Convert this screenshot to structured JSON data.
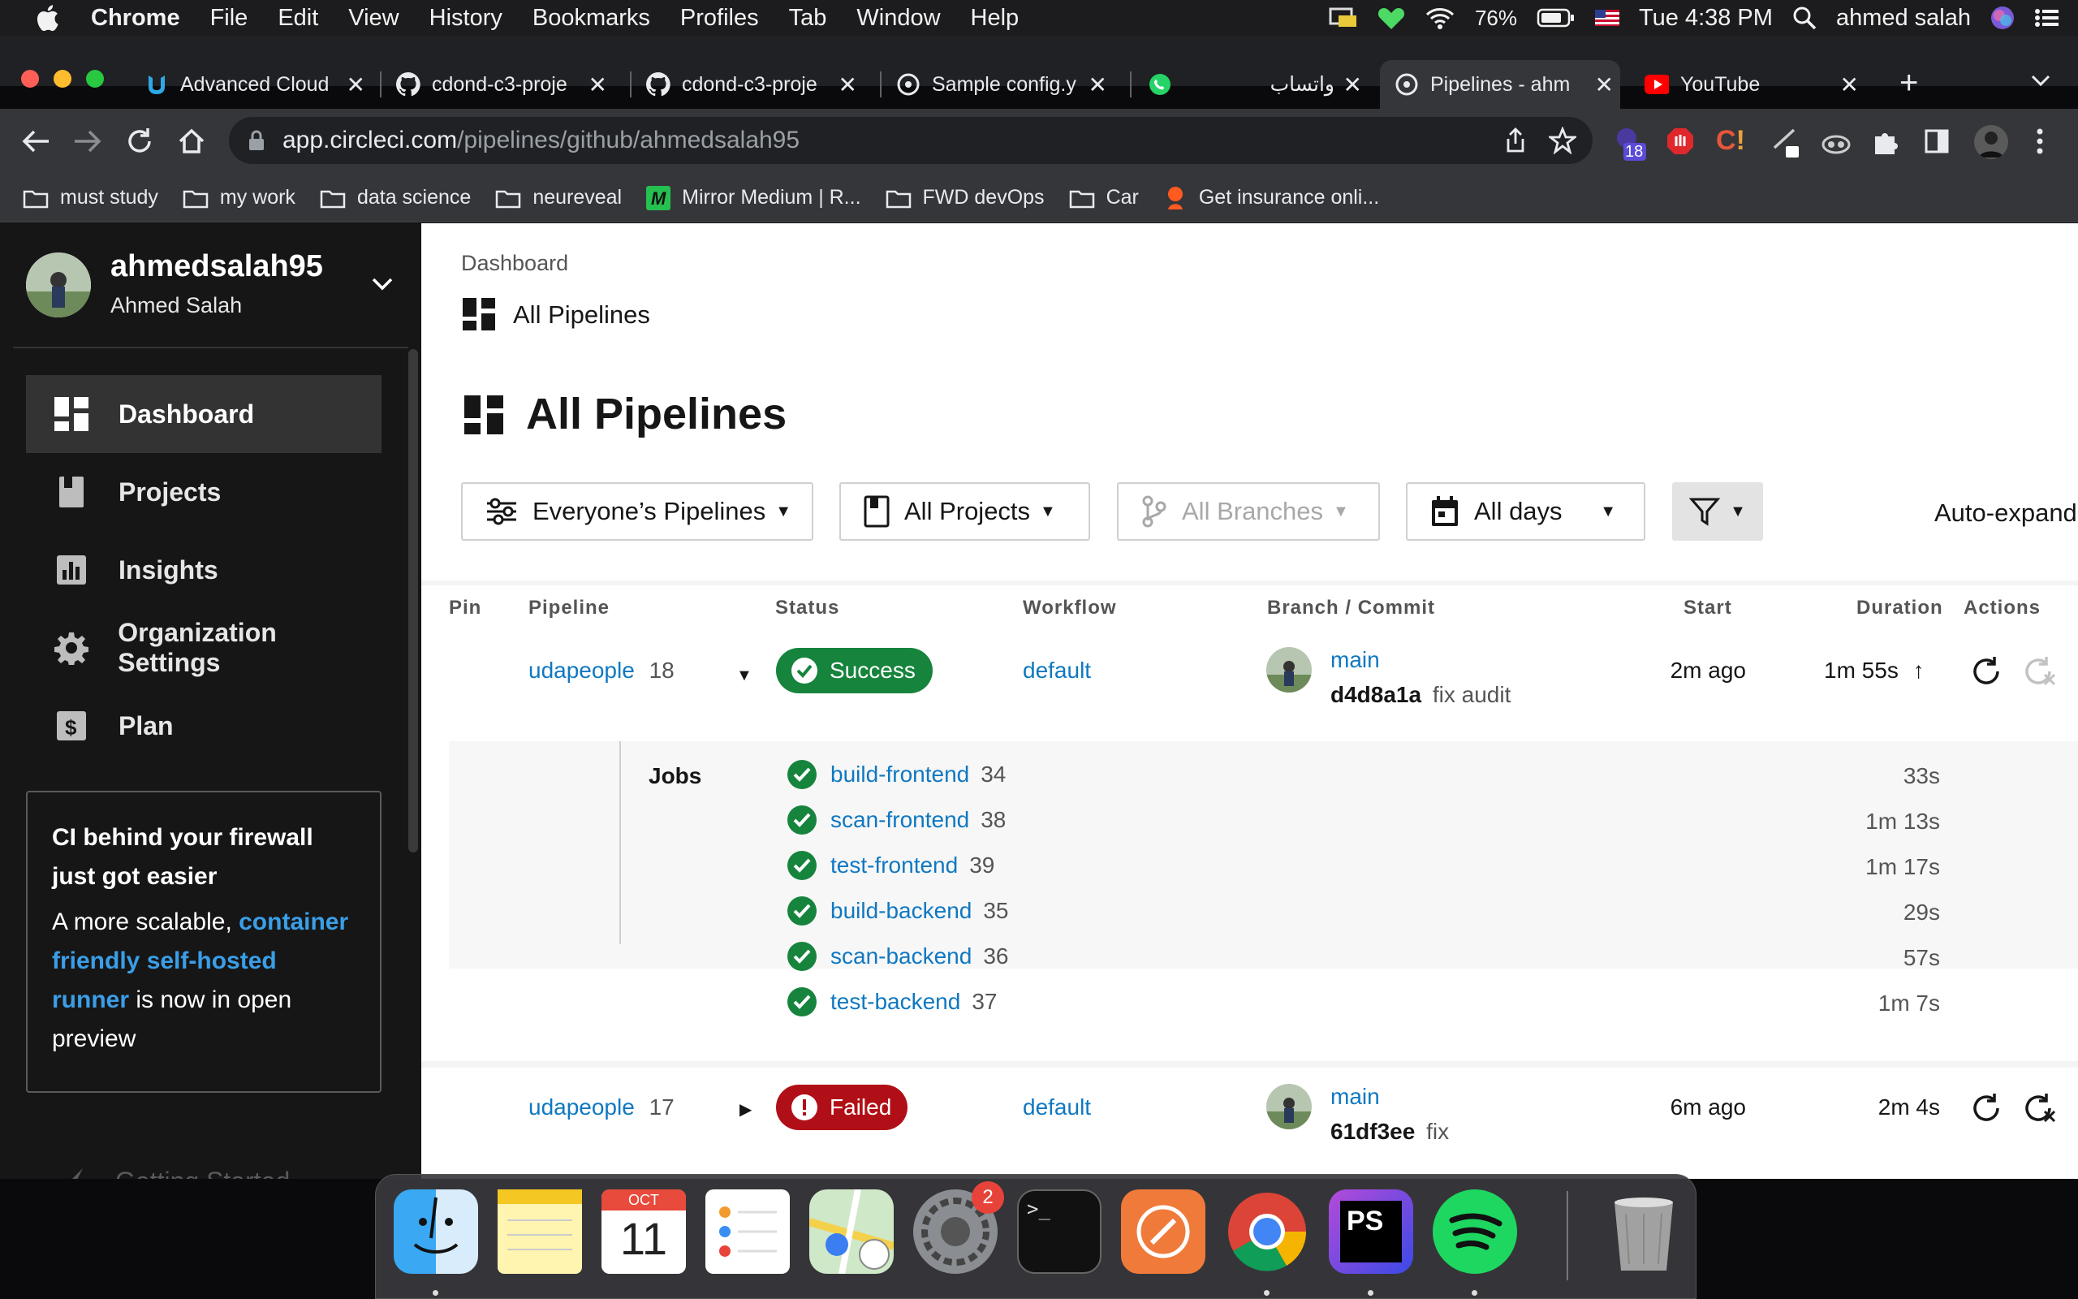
{
  "menubar": {
    "app": "Chrome",
    "items": [
      "File",
      "Edit",
      "View",
      "History",
      "Bookmarks",
      "Profiles",
      "Tab",
      "Window",
      "Help"
    ],
    "battery": "76%",
    "datetime": "Tue 4:38 PM",
    "user": "ahmed salah"
  },
  "tabs": [
    {
      "title": "Advanced Cloud",
      "icon": "udacity-icon"
    },
    {
      "title": "cdond-c3-proje",
      "icon": "github-icon"
    },
    {
      "title": "cdond-c3-proje",
      "icon": "github-icon"
    },
    {
      "title": "Sample config.y",
      "icon": "circleci-icon"
    },
    {
      "title": "",
      "icon": "whatsapp-icon"
    },
    {
      "title": "واتساب",
      "icon": ""
    },
    {
      "title": "Pipelines - ahm",
      "icon": "circleci-icon"
    },
    {
      "title": "YouTube",
      "icon": "youtube-icon"
    }
  ],
  "address": {
    "host": "app.circleci.com",
    "path": "/pipelines/github/ahmedsalah95"
  },
  "extension_badge": "18",
  "bookmarks": [
    "must study",
    "my work",
    "data science",
    "neureveal",
    "Mirror Medium | R...",
    "FWD devOps",
    "Car",
    "Get insurance onli..."
  ],
  "sidebar": {
    "org": "ahmedsalah95",
    "user": "Ahmed Salah",
    "nav": [
      "Dashboard",
      "Projects",
      "Insights",
      "Organization Settings",
      "Plan"
    ],
    "promo": {
      "title": "CI behind your firewall just got easier",
      "text_before": "A more scalable,",
      "link": "container friendly self-hosted runner",
      "text_after": "is now in open preview"
    },
    "partial_item": "Getting Started"
  },
  "main": {
    "breadcrumb": "Dashboard",
    "subtitle": "All Pipelines",
    "title": "All Pipelines",
    "filters": {
      "pipelines": "Everyone’s Pipelines",
      "projects": "All Projects",
      "branches": "All Branches",
      "days": "All days"
    },
    "auto_expand": "Auto-expand",
    "columns": [
      "Pin",
      "Pipeline",
      "Status",
      "Workflow",
      "Branch / Commit",
      "Start",
      "Duration",
      "Actions"
    ],
    "pipelines": [
      {
        "project": "udapeople",
        "number": "18",
        "status": "Success",
        "workflow": "default",
        "branch": "main",
        "commit": "d4d8a1a",
        "message": "fix audit",
        "start": "2m ago",
        "duration": "1m 55s",
        "jobs_label": "Jobs",
        "jobs": [
          {
            "name": "build-frontend",
            "number": "34",
            "duration": "33s"
          },
          {
            "name": "scan-frontend",
            "number": "38",
            "duration": "1m 13s"
          },
          {
            "name": "test-frontend",
            "number": "39",
            "duration": "1m 17s"
          },
          {
            "name": "build-backend",
            "number": "35",
            "duration": "29s"
          },
          {
            "name": "scan-backend",
            "number": "36",
            "duration": "57s"
          },
          {
            "name": "test-backend",
            "number": "37",
            "duration": "1m 7s"
          }
        ]
      },
      {
        "project": "udapeople",
        "number": "17",
        "status": "Failed",
        "workflow": "default",
        "branch": "main",
        "commit": "61df3ee",
        "message": "fix",
        "start": "6m ago",
        "duration": "2m 4s"
      }
    ]
  },
  "dock": {
    "calendar_month": "OCT",
    "calendar_day": "11",
    "settings_badge": "2",
    "apps": [
      "Finder",
      "Notes",
      "Calendar",
      "Reminders",
      "Maps",
      "System Preferences",
      "Terminal",
      "Postman",
      "Chrome",
      "PhpStorm",
      "Spotify",
      "Trash"
    ]
  },
  "colors": {
    "success": "#16843c",
    "failed": "#b10f17",
    "link": "#0f78c1",
    "sidebar_bg": "#161616"
  }
}
